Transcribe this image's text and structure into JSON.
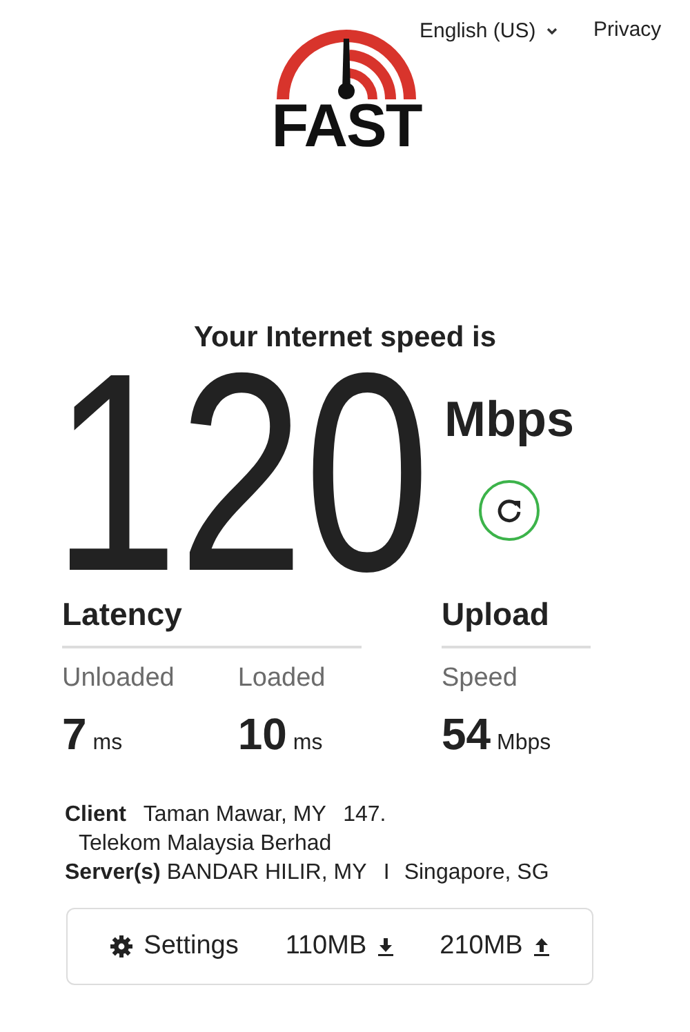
{
  "header": {
    "logo_text": "FAST",
    "language": "English (US)",
    "privacy": "Privacy"
  },
  "speed": {
    "label": "Your Internet speed is",
    "value": "120",
    "unit": "Mbps"
  },
  "latency": {
    "title": "Latency",
    "metrics": [
      {
        "label": "Unloaded",
        "value": "7",
        "unit": "ms"
      },
      {
        "label": "Loaded",
        "value": "10",
        "unit": "ms"
      }
    ]
  },
  "upload": {
    "title": "Upload",
    "metrics": [
      {
        "label": "Speed",
        "value": "54",
        "unit": "Mbps"
      }
    ]
  },
  "client": {
    "label": "Client",
    "location": "Taman Mawar, MY",
    "ip": "147.",
    "isp": "Telekom Malaysia Berhad"
  },
  "servers": {
    "label": "Server(s)",
    "items": [
      "BANDAR HILIR, MY",
      "Singapore, SG"
    ],
    "separator": "I"
  },
  "settings": {
    "label": "Settings",
    "download": "110MB",
    "upload": "210MB"
  }
}
